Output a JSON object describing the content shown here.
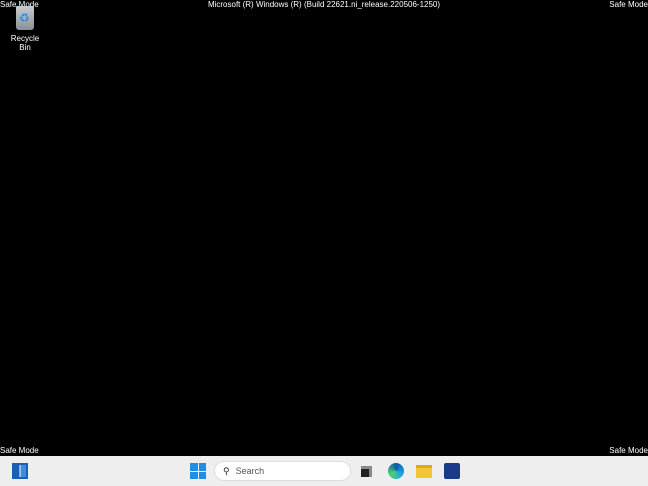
{
  "overlay": {
    "safe_mode": "Safe Mode",
    "build": "Microsoft (R) Windows (R) (Build 22621.ni_release.220506-1250)"
  },
  "desktop": {
    "recycle_bin": "Recycle Bin"
  },
  "taskbar": {
    "search_placeholder": "Search",
    "search_icon": "🔍"
  }
}
